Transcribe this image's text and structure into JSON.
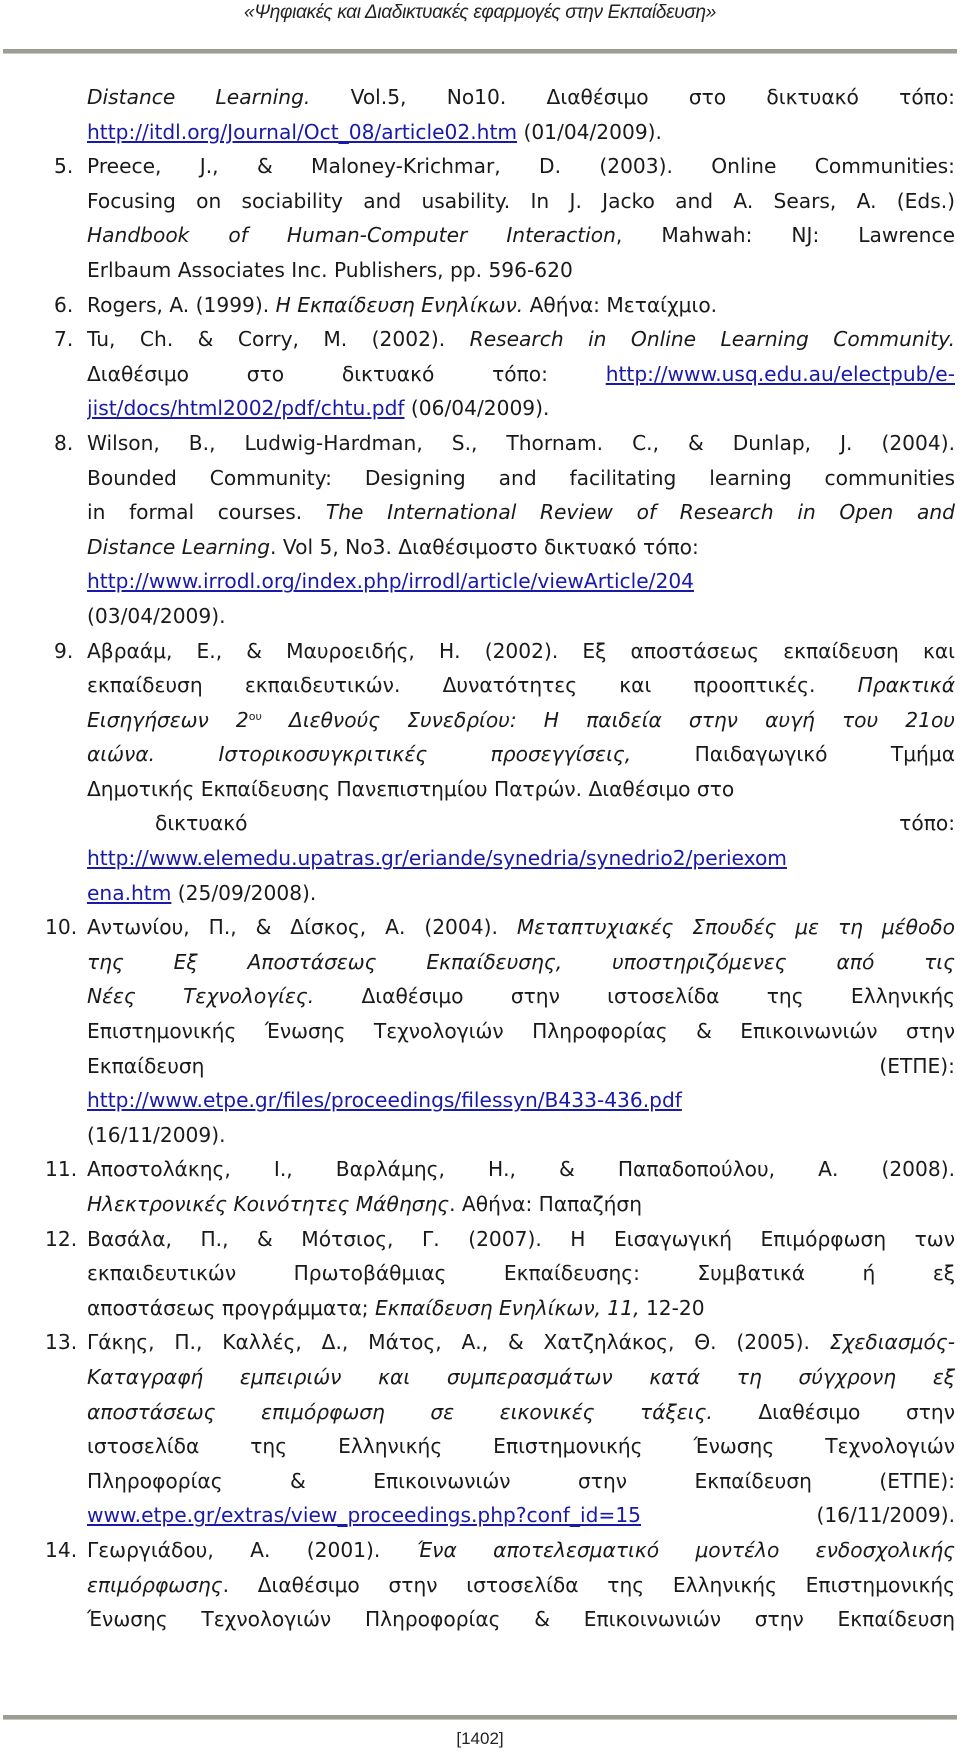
{
  "header": {
    "title": "«Ψηφιακές και Διαδικτυακές εφαρμογές στην Εκπαίδευση»"
  },
  "footer": {
    "page_number": "[1402]"
  },
  "colors": {
    "text": "#1a1a1a",
    "link": "#1a1aa8",
    "rule": "#9c9e94"
  },
  "lines": [
    {
      "n": "",
      "parts": [
        {
          "t": "Distance Learning.",
          "i": true
        },
        {
          "t": " Vol.5, No10. Διαθέσιμο στο δικτυακό τόπο:"
        }
      ]
    },
    {
      "n": "",
      "left": true,
      "parts": [
        {
          "t": "http://itdl.org/Journal/Oct_08/article02.htm",
          "link": true
        },
        {
          "t": " (01/04/2009)."
        }
      ]
    },
    {
      "n": "5.",
      "parts": [
        {
          "t": "Preece, J., & Maloney-Krichmar, D. (2003). Online Communities:"
        }
      ]
    },
    {
      "n": "",
      "parts": [
        {
          "t": "Focusing on sociability and usability. In J. Jacko and A. Sears, A. (Eds.)"
        }
      ]
    },
    {
      "n": "",
      "parts": [
        {
          "t": "Handbook of Human-Computer Interaction",
          "i": true
        },
        {
          "t": ", Mahwah: NJ: Lawrence"
        }
      ]
    },
    {
      "n": "",
      "left": true,
      "parts": [
        {
          "t": "Erlbaum Associates Inc. Publishers, pp. 596-620"
        }
      ]
    },
    {
      "n": "6.",
      "left": true,
      "parts": [
        {
          "t": "Rogers, A. (1999). "
        },
        {
          "t": "Η Εκπαίδευση Ενηλίκων.",
          "i": true
        },
        {
          "t": " Αθήνα: Μεταίχμιο."
        }
      ]
    },
    {
      "n": "7.",
      "parts": [
        {
          "t": "Tu, Ch. & Corry, M. (2002). "
        },
        {
          "t": "Research in Online Learning Community.",
          "i": true
        }
      ]
    },
    {
      "n": "",
      "parts": [
        {
          "t": "Διαθέσιμο στο δικτυακό τόπο: "
        },
        {
          "t": "http://www.usq.edu.au/electpub/e-",
          "link": true
        }
      ]
    },
    {
      "n": "",
      "left": true,
      "parts": [
        {
          "t": "jist/docs/html2002/pdf/chtu.pdf",
          "link": true
        },
        {
          "t": " (06/04/2009)."
        }
      ]
    },
    {
      "n": "8.",
      "parts": [
        {
          "t": "Wilson, B., Ludwig-Hardman, S., Thornam. C., & Dunlap, J. (2004)."
        }
      ]
    },
    {
      "n": "",
      "parts": [
        {
          "t": "Bounded Community: Designing and facilitating learning communities"
        }
      ]
    },
    {
      "n": "",
      "parts": [
        {
          "t": "in formal courses. "
        },
        {
          "t": "The International Review of Research in Open and",
          "i": true
        }
      ]
    },
    {
      "n": "",
      "left": true,
      "parts": [
        {
          "t": "Distance Learning",
          "i": true
        },
        {
          "t": ". Vol 5, No3. Διαθέσιμοστο δικτυακό τόπο:"
        }
      ]
    },
    {
      "n": "",
      "left": true,
      "parts": [
        {
          "t": "http://www.irrodl.org/index.php/irrodl/article/viewArticle/204",
          "link": true
        }
      ]
    },
    {
      "n": "",
      "left": true,
      "parts": [
        {
          "t": "(03/04/2009)."
        }
      ]
    },
    {
      "n": "9.",
      "parts": [
        {
          "t": "Αβραάμ, Ε., & Μαυροειδής, Η. (2002). Εξ αποστάσεως εκπαίδευση και"
        }
      ]
    },
    {
      "n": "",
      "parts": [
        {
          "t": "εκπαίδευση εκπαιδευτικών. Δυνατότητες και προοπτικές. "
        },
        {
          "t": "Πρακτικά",
          "i": true
        }
      ]
    },
    {
      "n": "",
      "parts": [
        {
          "t": "Εισηγήσεων 2",
          "i": true
        },
        {
          "t": "ου",
          "sup": true
        },
        {
          "t": " Διεθνούς Συνεδρίου: Η παιδεία στην αυγή του 21ου",
          "i": true
        }
      ]
    },
    {
      "n": "",
      "parts": [
        {
          "t": "αιώνα. Ιστορικοσυγκριτικές προσεγγίσεις,",
          "i": true
        },
        {
          "t": " Παιδαγωγικό Τμήμα"
        }
      ]
    },
    {
      "n": "",
      "left": true,
      "parts": [
        {
          "t": "Δημοτικής  Εκπαίδευσης Πανεπιστημίου Πατρών.  Διαθέσιμο  στο"
        }
      ]
    },
    {
      "n": "",
      "indent": true,
      "parts": [
        {
          "t": "δικτυακό τόπο:"
        }
      ]
    },
    {
      "n": "",
      "parts": [
        {
          "t": "http://www.elemedu.upatras.gr/eriande/synedria/synedrio2/periexom",
          "link": true
        }
      ]
    },
    {
      "n": "",
      "left": true,
      "parts": [
        {
          "t": "ena.htm",
          "link": true
        },
        {
          "t": "  (25/09/2008)."
        }
      ]
    },
    {
      "n": "10.",
      "parts": [
        {
          "t": "Αντωνίου, Π., & Δίσκος, Α. (2004). "
        },
        {
          "t": "Μεταπτυχιακές Σπουδές με τη μέθοδο",
          "i": true
        }
      ]
    },
    {
      "n": "",
      "parts": [
        {
          "t": "της Εξ Αποστάσεως Εκπαίδευσης, υποστηριζόμενες από τις",
          "i": true
        }
      ]
    },
    {
      "n": "",
      "parts": [
        {
          "t": "Νέες Τεχνολογίες.",
          "i": true
        },
        {
          "t": " Διαθέσιμο στην ιστοσελίδα της Ελληνικής"
        }
      ]
    },
    {
      "n": "",
      "parts": [
        {
          "t": "Επιστημονικής Ένωσης Τεχνολογιών Πληροφορίας & Επικοινωνιών στην"
        }
      ]
    },
    {
      "n": "",
      "parts": [
        {
          "t": "Εκπαίδευση (ΕΤΠΕ):"
        }
      ]
    },
    {
      "n": "",
      "left": true,
      "parts": [
        {
          "t": "http://www.etpe.gr/files/proceedings/filessyn/B433-436.pdf",
          "link": true
        }
      ]
    },
    {
      "n": "",
      "left": true,
      "parts": [
        {
          "t": "(16/11/2009)."
        }
      ]
    },
    {
      "n": "11.",
      "parts": [
        {
          "t": "Αποστολάκης, Ι., Βαρλάμης, Η., & Παπαδοπούλου, Α. (2008)."
        }
      ]
    },
    {
      "n": "",
      "left": true,
      "parts": [
        {
          "t": "Ηλεκτρονικές Κοινότητες Μάθησης",
          "i": true
        },
        {
          "t": ". Αθήνα: Παπαζήση"
        }
      ]
    },
    {
      "n": "12.",
      "parts": [
        {
          "t": "Βασάλα, Π., & Μότσιος, Γ. (2007). Η Εισαγωγική Επιμόρφωση των"
        }
      ]
    },
    {
      "n": "",
      "parts": [
        {
          "t": "εκπαιδευτικών Πρωτοβάθμιας Εκπαίδευσης: Συμβατικά ή εξ"
        }
      ]
    },
    {
      "n": "",
      "left": true,
      "parts": [
        {
          "t": "αποστάσεως προγράμματα; "
        },
        {
          "t": "Εκπαίδευση Ενηλίκων, 11,",
          "i": true
        },
        {
          "t": " 12-20"
        }
      ]
    },
    {
      "n": "13.",
      "parts": [
        {
          "t": "Γάκης, Π., Καλλές, Δ., Μάτος, Α., & Χατζηλάκος, Θ. (2005). "
        },
        {
          "t": "Σχεδιασμός-",
          "i": true
        }
      ]
    },
    {
      "n": "",
      "parts": [
        {
          "t": "Καταγραφή εμπειριών και συμπερασμάτων κατά τη σύγχρονη εξ",
          "i": true
        }
      ]
    },
    {
      "n": "",
      "parts": [
        {
          "t": "αποστάσεως επιμόρφωση σε εικονικές τάξεις.",
          "i": true
        },
        {
          "t": " Διαθέσιμο στην"
        }
      ]
    },
    {
      "n": "",
      "parts": [
        {
          "t": "ιστοσελίδα της Ελληνικής Επιστημονικής Ένωσης Τεχνολογιών"
        }
      ]
    },
    {
      "n": "",
      "parts": [
        {
          "t": "Πληροφορίας & Επικοινωνιών στην Εκπαίδευση (ΕΤΠΕ):"
        }
      ]
    },
    {
      "n": "",
      "parts": [
        {
          "t": "www.etpe.gr/extras/view_proceedings.php?conf_id=15",
          "link": true
        },
        {
          "t": "  (16/11/2009)."
        }
      ]
    },
    {
      "n": "14.",
      "parts": [
        {
          "t": "Γεωργιάδου, Α. (2001). "
        },
        {
          "t": "Ένα αποτελεσματικό μοντέλο ενδοσχολικής",
          "i": true
        }
      ]
    },
    {
      "n": "",
      "parts": [
        {
          "t": "επιμόρφωσης",
          "i": true
        },
        {
          "t": ". Διαθέσιμο στην ιστοσελίδα της Ελληνικής Επιστημονικής"
        }
      ]
    },
    {
      "n": "",
      "parts": [
        {
          "t": "Ένωσης Τεχνολογιών Πληροφορίας & Επικοινωνιών στην Εκπαίδευση"
        }
      ]
    }
  ]
}
